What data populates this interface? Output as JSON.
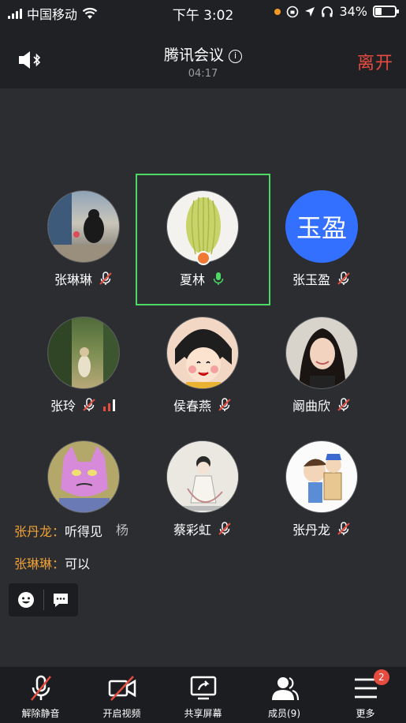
{
  "status_bar": {
    "carrier": "中国移动",
    "time": "下午 3:02",
    "battery": "34%",
    "battery_level": 0.34
  },
  "meeting": {
    "title": "腾讯会议",
    "timer": "04:17",
    "leave_label": "离开"
  },
  "participants": [
    {
      "name": "张琳琳",
      "muted": true
    },
    {
      "name": "夏林",
      "muted": false,
      "active": true
    },
    {
      "name": "张玉盈",
      "muted": true,
      "initials": "玉盈"
    },
    {
      "name": "张玲",
      "muted": true,
      "signal": true
    },
    {
      "name": "侯春燕",
      "muted": true
    },
    {
      "name": "阚曲欣",
      "muted": true
    },
    {
      "name": "杨",
      "muted": true
    },
    {
      "name": "蔡彩虹",
      "muted": true
    },
    {
      "name": "张丹龙",
      "muted": true
    }
  ],
  "chat": [
    {
      "sender": "张丹龙：",
      "text": "听得见"
    },
    {
      "sender": "张琳琳：",
      "text": "可以"
    }
  ],
  "toolbar": {
    "unmute": "解除静音",
    "video": "开启视频",
    "share": "共享屏幕",
    "members": "成员(9)",
    "more": "更多",
    "more_badge": "2"
  },
  "colors": {
    "accent_green": "#4cd964",
    "leave_red": "#e64b40",
    "sender_orange": "#f0a035"
  }
}
